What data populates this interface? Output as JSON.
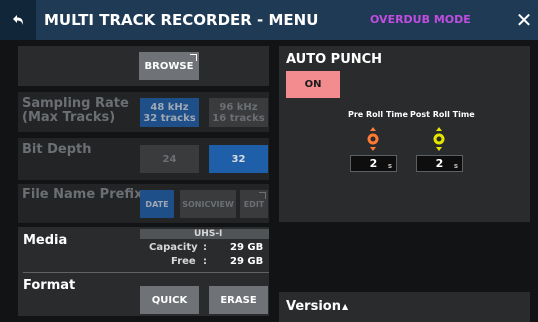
{
  "header": {
    "title": "MULTI TRACK RECORDER - MENU",
    "mode": "OVERDUB MODE",
    "close_glyph": "✕",
    "back_icon": "return-arrow-icon"
  },
  "left": {
    "browse_label": "BROWSE",
    "sampling": {
      "label_line1": "Sampling Rate",
      "label_line2": "(Max Tracks)",
      "opt1_line1": "48 kHz",
      "opt1_line2": "32 tracks",
      "opt2_line1": "96 kHz",
      "opt2_line2": "16 tracks"
    },
    "bit_depth": {
      "label": "Bit Depth",
      "opt1": "24",
      "opt2": "32"
    },
    "file_prefix": {
      "label": "File Name Prefix",
      "opt1": "DATE",
      "opt2": "SONICVIEW",
      "opt3": "EDIT"
    },
    "media": {
      "label": "Media",
      "type": "UHS-I",
      "capacity_label": "Capacity",
      "capacity_value": "29 GB",
      "free_label": "Free",
      "free_value": "29 GB",
      "colon": ":"
    },
    "format": {
      "label": "Format",
      "quick": "QUICK",
      "erase": "ERASE"
    }
  },
  "right": {
    "auto_punch": {
      "title": "AUTO PUNCH",
      "toggle": "ON",
      "pre_roll_label": "Pre Roll Time",
      "post_roll_label": "Post Roll Time",
      "pre_roll_value": "2",
      "post_roll_value": "2",
      "unit": "s",
      "pre_knob_color": "#ff7a33",
      "post_knob_color": "#e6e600"
    },
    "version": {
      "label": "Version",
      "arrow": "▲"
    }
  },
  "colors": {
    "header_bg": "#1f3a55",
    "panel_bg": "#2a2b2d",
    "accent_blue": "#1f5ea8",
    "mode_purple": "#c04de0",
    "on_pink": "#f38c8f"
  }
}
